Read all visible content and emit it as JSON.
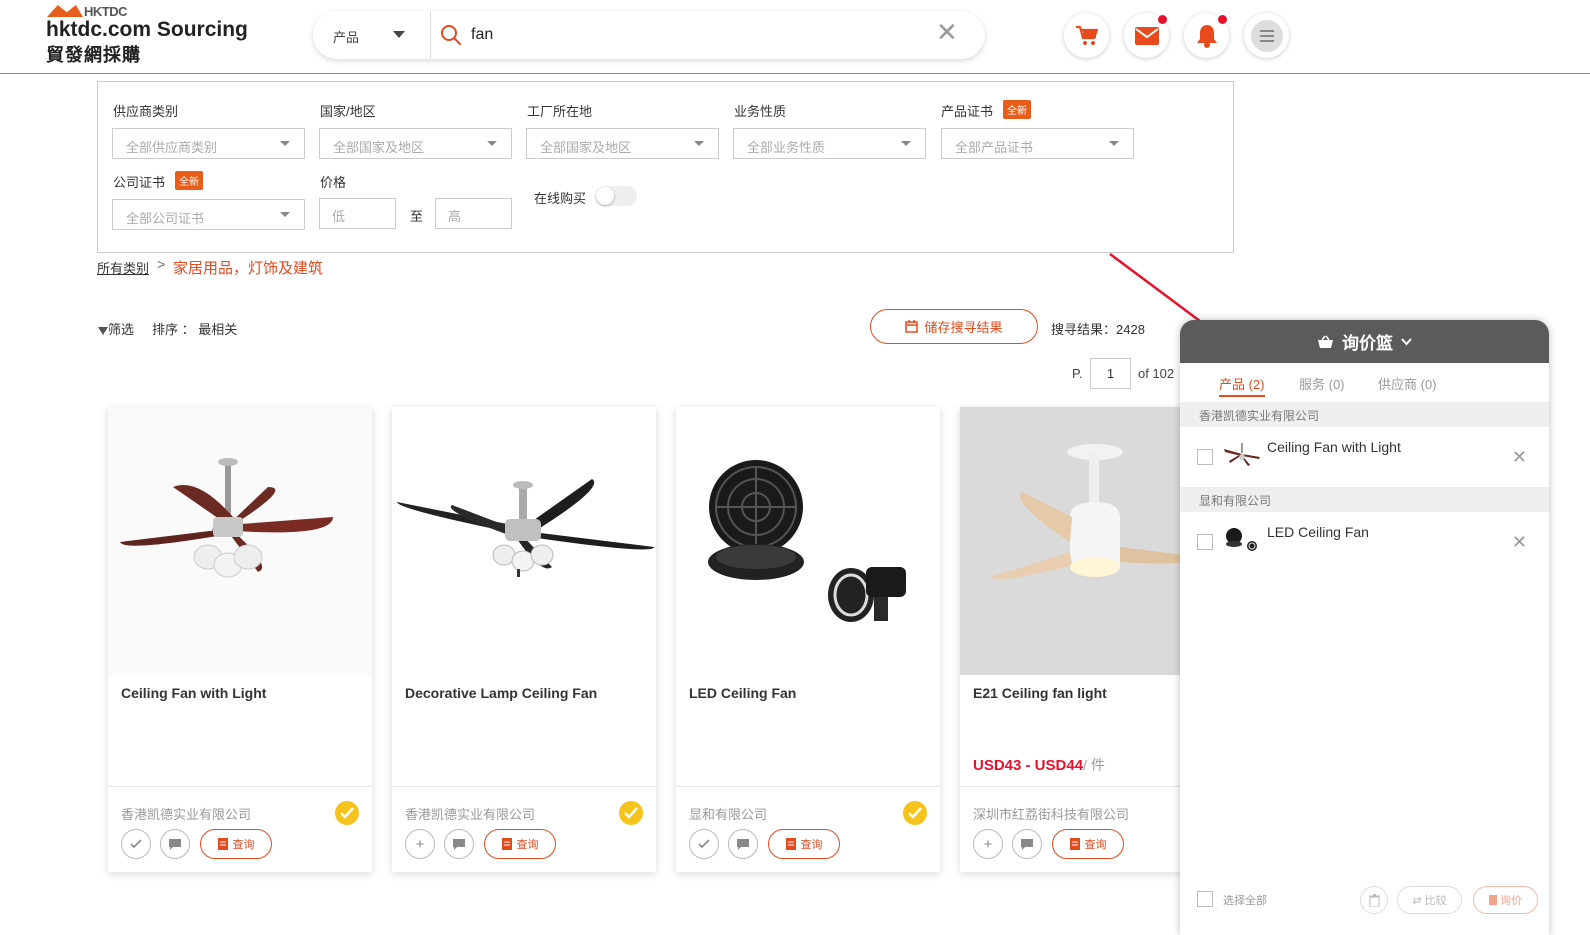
{
  "header": {
    "logo_small": "HKTDC",
    "logo_main": "hktdc.com Sourcing",
    "logo_sub": "貿發網採購",
    "search_category": "产品",
    "search_value": "fan"
  },
  "filters": {
    "supplier_type_label": "供应商类别",
    "supplier_type_value": "全部供应商类别",
    "country_label": "国家/地区",
    "country_value": "全部国家及地区",
    "factory_label": "工厂所在地",
    "factory_value": "全部国家及地区",
    "business_label": "业务性质",
    "business_value": "全部业务性质",
    "product_cert_label": "产品证书",
    "product_cert_value": "全部产品证书",
    "company_cert_label": "公司证书",
    "company_cert_value": "全部公司证书",
    "new_badge": "全新",
    "price_label": "价格",
    "price_low": "低",
    "price_to": "至",
    "price_high": "高",
    "online_buy_label": "在线购买"
  },
  "breadcrumb": {
    "all": "所有类别",
    "separator": ">",
    "current": "家居用品，灯饰及建筑"
  },
  "toolbar": {
    "filter": "筛选",
    "sort": "排序 ： 最相关",
    "save_search": "储存搜寻结果",
    "result_count": "搜寻结果：2428",
    "page_prefix": "P.",
    "page_value": "1",
    "page_of": "of 102"
  },
  "products": [
    {
      "title": "Ceiling Fan with Light",
      "price": "",
      "unit": "",
      "supplier": "香港凯德实业有限公司",
      "inquiry": "查询"
    },
    {
      "title": "Decorative Lamp Ceiling Fan",
      "price": "",
      "unit": "",
      "supplier": "香港凯德实业有限公司",
      "inquiry": "查询"
    },
    {
      "title": "LED Ceiling Fan",
      "price": "",
      "unit": "",
      "supplier": "显和有限公司",
      "inquiry": "查询"
    },
    {
      "title": "E21 Ceiling fan light",
      "price": "USD43 - USD44",
      "unit": "/ 件",
      "supplier": "深圳市红荔街科技有限公司",
      "inquiry": "查询"
    }
  ],
  "basket": {
    "title": "询价篮",
    "tabs": [
      {
        "label": "产品 (2)"
      },
      {
        "label": "服务 (0)"
      },
      {
        "label": "供应商 (0)"
      }
    ],
    "groups": [
      {
        "supplier": "香港凯德实业有限公司",
        "item": "Ceiling Fan with Light"
      },
      {
        "supplier": "显和有限公司",
        "item": "LED Ceiling Fan"
      }
    ],
    "select_all": "选择全部",
    "compare": "比较",
    "inquire": "询价"
  },
  "colors": {
    "accent": "#e84a1d",
    "brand_orange": "#e95d1b",
    "notification_dot": "#e8112d",
    "basket_header": "#5b5b5b",
    "verified_badge": "#f6c21c"
  }
}
